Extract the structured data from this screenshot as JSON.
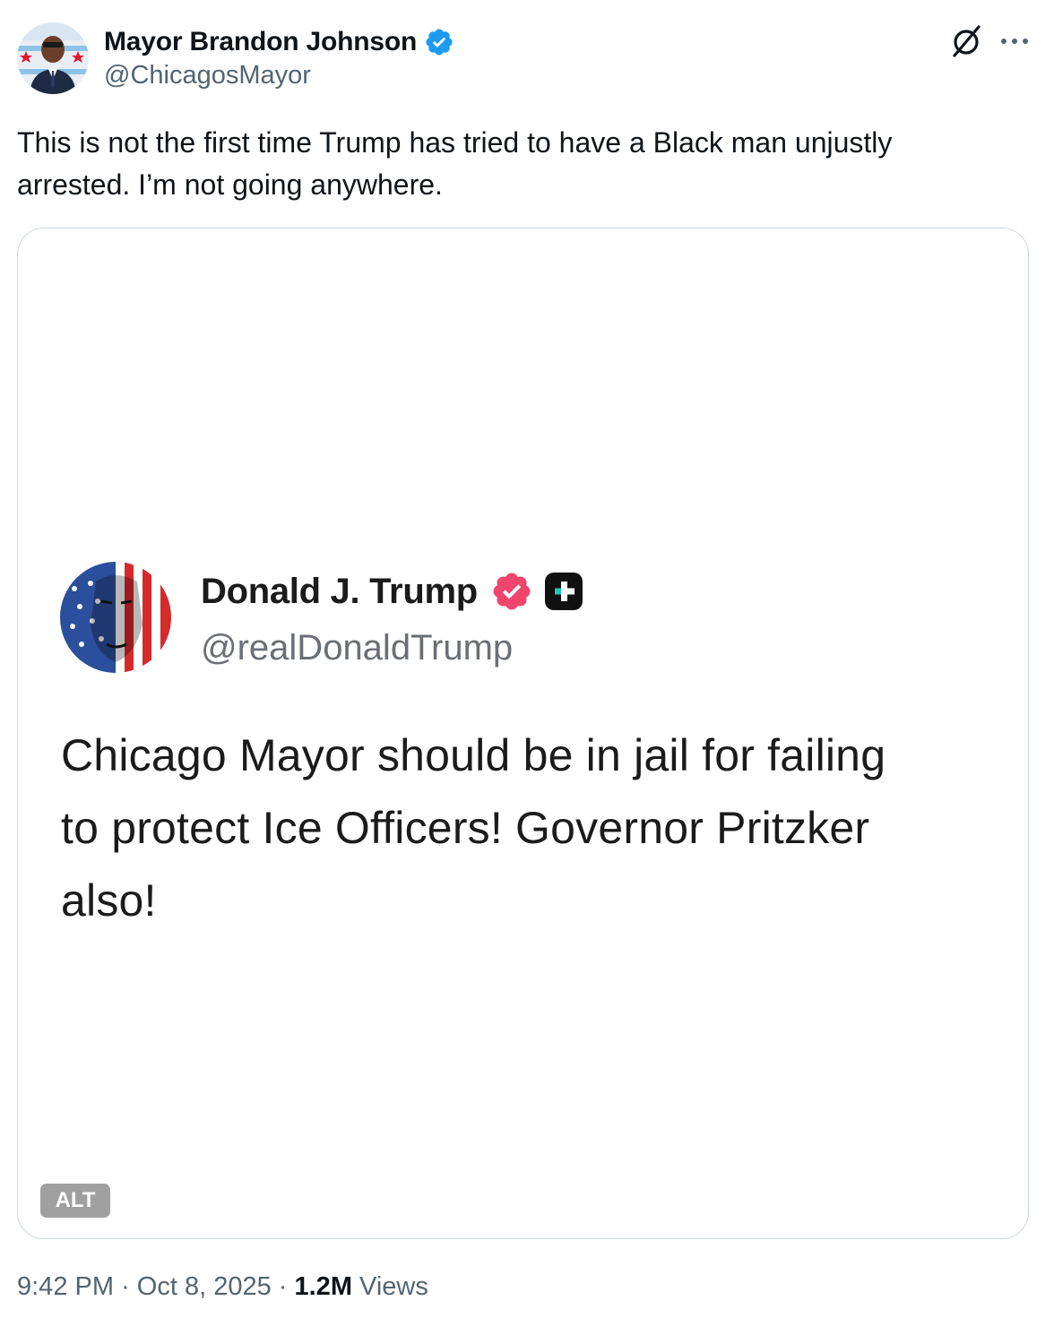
{
  "post": {
    "author": {
      "display_name": "Mayor Brandon Johnson",
      "handle": "@ChicagosMayor",
      "verified": true,
      "verified_color": "#1d9bf0"
    },
    "text_line1": "This is not the first time Trump has tried to have a Black man unjustly",
    "text_line2": "arrested. I’m not going anywhere.",
    "header_icons": [
      "grok-icon",
      "more-icon"
    ],
    "media": {
      "alt_label": "ALT",
      "embedded_post": {
        "author_name": "Donald J. Trump",
        "handle": "@realDonaldTrump",
        "badge_color": "#f0466e",
        "line1": "Chicago Mayor should be in jail for failing",
        "line2": "to protect Ice Officers! Governor Pritzker",
        "line3": "also!"
      }
    },
    "meta": {
      "time": "9:42 PM",
      "separator": " · ",
      "date": "Oct 8, 2025",
      "views_count": "1.2M",
      "views_label": " Views"
    }
  }
}
